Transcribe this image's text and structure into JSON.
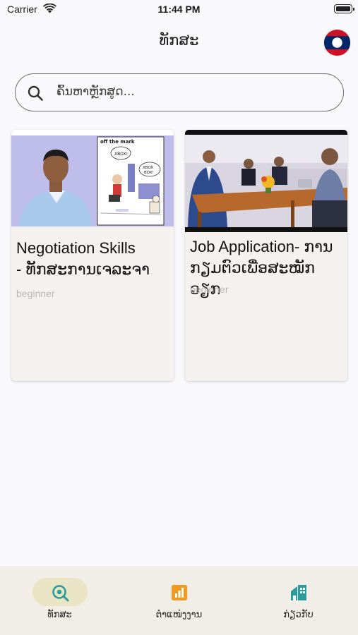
{
  "status_bar": {
    "carrier": "Carrier",
    "time": "11:44 PM"
  },
  "header": {
    "title": "ທັກສະ",
    "language_flag": "laos-flag-icon"
  },
  "search": {
    "placeholder": "ຄົ້ນຫາຫຼັກສູດ..."
  },
  "courses": [
    {
      "title_line1": "Negotiation Skills",
      "title_line2": "- ທັກສະການເຈລະຈາ",
      "level": "beginner",
      "thumbnail": "negotiation-video-thumbnail"
    },
    {
      "title_line1": "Job Application- ການ",
      "title_line2": "ກຽມຕົວເພື່ອສະໝັກວຽກ",
      "level": "beginner",
      "thumbnail": "job-application-video-thumbnail"
    }
  ],
  "tabs": [
    {
      "label": "ທັກສະ",
      "icon": "skills-search-icon",
      "active": true
    },
    {
      "label": "ຕຳແໜ່ງງານ",
      "icon": "jobs-chart-icon",
      "active": false
    },
    {
      "label": "ກ່ຽວກັບ",
      "icon": "about-building-icon",
      "active": false
    }
  ],
  "colors": {
    "background": "#f9f8fb",
    "card": "#f4f1ef",
    "tabbar": "#f1ede7",
    "active_pill": "#e9e4c4",
    "teal": "#2b9b9b",
    "orange": "#f29a1f"
  }
}
